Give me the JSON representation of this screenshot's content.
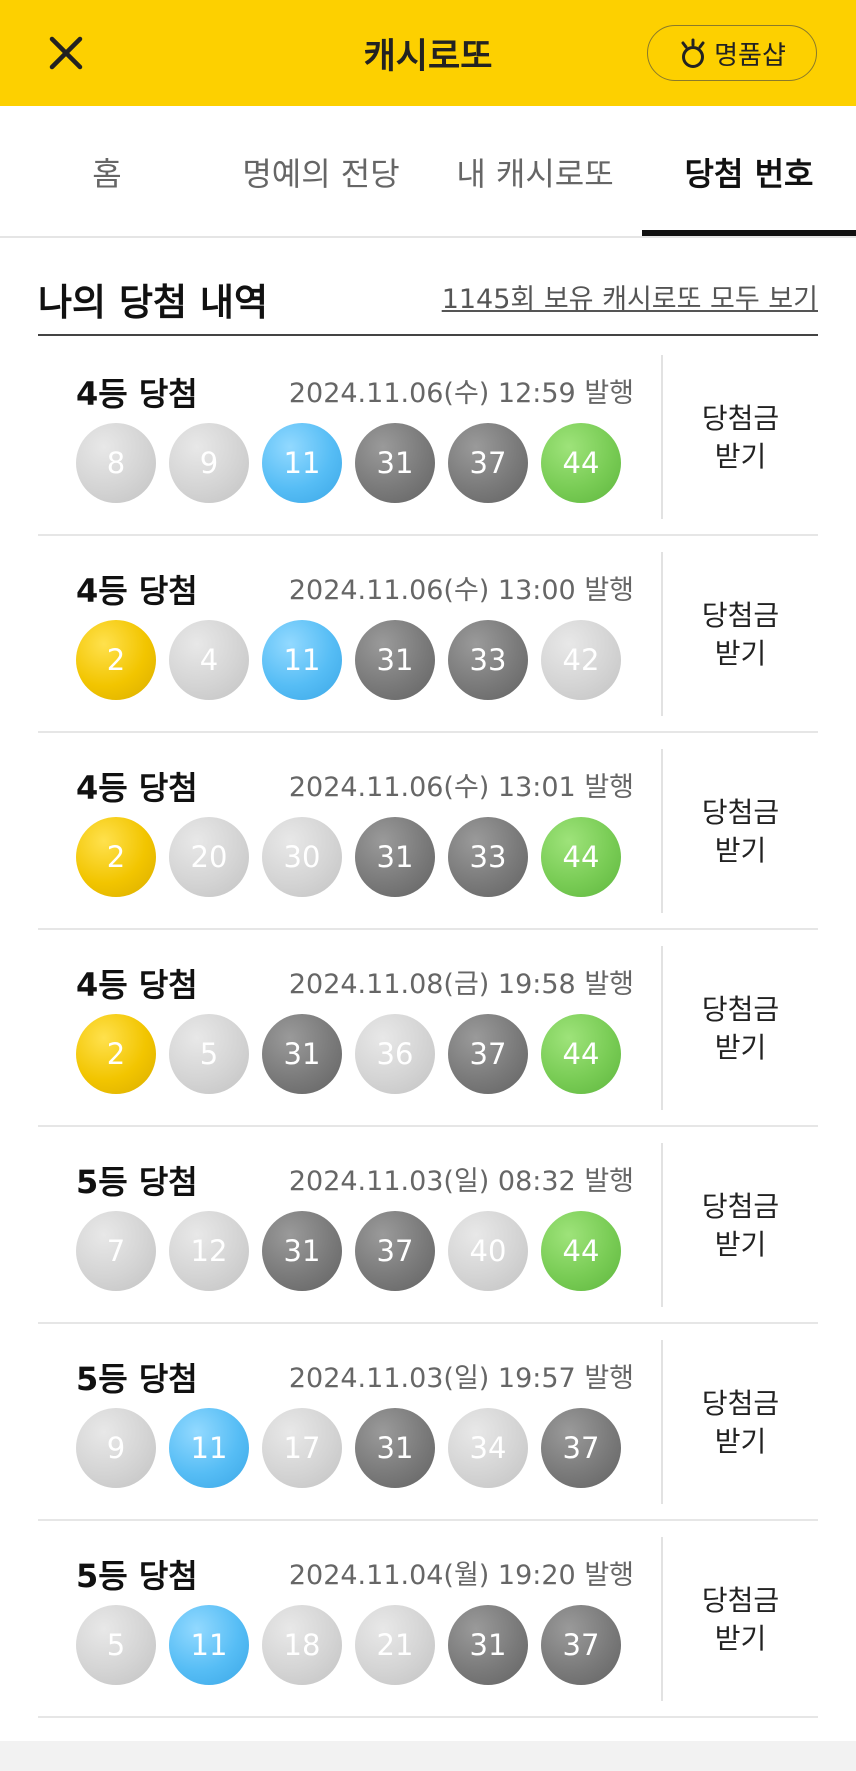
{
  "header": {
    "title": "캐시로또",
    "close_icon": "close-icon",
    "shop_label": "명품샵",
    "shop_icon": "prize-medal-icon",
    "background": "#FDD000"
  },
  "tabs": [
    {
      "label": "홈",
      "active": false
    },
    {
      "label": "명예의 전당",
      "active": false
    },
    {
      "label": "내 캐시로또",
      "active": false
    },
    {
      "label": "당첨 번호",
      "active": true
    }
  ],
  "section": {
    "title": "나의 당첨 내역",
    "link": "1145회 보유 캐시로또 모두 보기"
  },
  "claim": {
    "line1": "당첨금",
    "line2": "받기"
  },
  "ball_colors": {
    "yellow": "#F2C500",
    "blue": "#56BDF5",
    "dark": "#7A7A7A",
    "light": "#D4D4D4",
    "green": "#79CC55"
  },
  "wins": [
    {
      "rank": "4등 당첨",
      "date": "2024.11.06(수) 12:59 발행",
      "balls": [
        {
          "n": "8",
          "c": "light"
        },
        {
          "n": "9",
          "c": "light"
        },
        {
          "n": "11",
          "c": "blue"
        },
        {
          "n": "31",
          "c": "dark"
        },
        {
          "n": "37",
          "c": "dark"
        },
        {
          "n": "44",
          "c": "green"
        }
      ]
    },
    {
      "rank": "4등 당첨",
      "date": "2024.11.06(수) 13:00 발행",
      "balls": [
        {
          "n": "2",
          "c": "yellow"
        },
        {
          "n": "4",
          "c": "light"
        },
        {
          "n": "11",
          "c": "blue"
        },
        {
          "n": "31",
          "c": "dark"
        },
        {
          "n": "33",
          "c": "dark"
        },
        {
          "n": "42",
          "c": "light"
        }
      ]
    },
    {
      "rank": "4등 당첨",
      "date": "2024.11.06(수) 13:01 발행",
      "balls": [
        {
          "n": "2",
          "c": "yellow"
        },
        {
          "n": "20",
          "c": "light"
        },
        {
          "n": "30",
          "c": "light"
        },
        {
          "n": "31",
          "c": "dark"
        },
        {
          "n": "33",
          "c": "dark"
        },
        {
          "n": "44",
          "c": "green"
        }
      ]
    },
    {
      "rank": "4등 당첨",
      "date": "2024.11.08(금) 19:58 발행",
      "balls": [
        {
          "n": "2",
          "c": "yellow"
        },
        {
          "n": "5",
          "c": "light"
        },
        {
          "n": "31",
          "c": "dark"
        },
        {
          "n": "36",
          "c": "light"
        },
        {
          "n": "37",
          "c": "dark"
        },
        {
          "n": "44",
          "c": "green"
        }
      ]
    },
    {
      "rank": "5등 당첨",
      "date": "2024.11.03(일) 08:32 발행",
      "balls": [
        {
          "n": "7",
          "c": "light"
        },
        {
          "n": "12",
          "c": "light"
        },
        {
          "n": "31",
          "c": "dark"
        },
        {
          "n": "37",
          "c": "dark"
        },
        {
          "n": "40",
          "c": "light"
        },
        {
          "n": "44",
          "c": "green"
        }
      ]
    },
    {
      "rank": "5등 당첨",
      "date": "2024.11.03(일) 19:57 발행",
      "balls": [
        {
          "n": "9",
          "c": "light"
        },
        {
          "n": "11",
          "c": "blue"
        },
        {
          "n": "17",
          "c": "light"
        },
        {
          "n": "31",
          "c": "dark"
        },
        {
          "n": "34",
          "c": "light"
        },
        {
          "n": "37",
          "c": "dark"
        }
      ]
    },
    {
      "rank": "5등 당첨",
      "date": "2024.11.04(월) 19:20 발행",
      "balls": [
        {
          "n": "5",
          "c": "light"
        },
        {
          "n": "11",
          "c": "blue"
        },
        {
          "n": "18",
          "c": "light"
        },
        {
          "n": "21",
          "c": "light"
        },
        {
          "n": "31",
          "c": "dark"
        },
        {
          "n": "37",
          "c": "dark"
        }
      ]
    }
  ]
}
